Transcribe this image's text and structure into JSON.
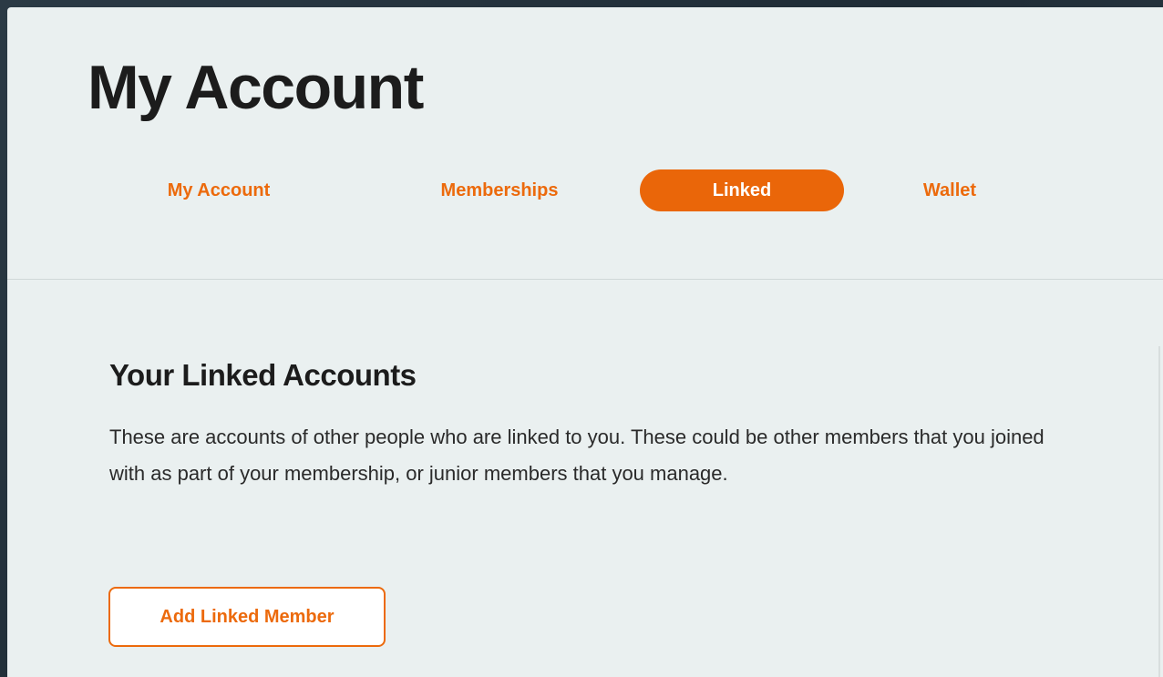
{
  "page": {
    "title": "My Account"
  },
  "tabs": [
    {
      "label": "My Account",
      "active": false
    },
    {
      "label": "Memberships",
      "active": false
    },
    {
      "label": "Linked",
      "active": true
    },
    {
      "label": "Wallet",
      "active": false
    }
  ],
  "linked_section": {
    "title": "Your Linked Accounts",
    "description": "These are accounts of other people who are linked to you. These could be other members that you joined with as part of your membership, or junior members that you manage.",
    "add_button_label": "Add Linked Member"
  },
  "colors": {
    "accent": "#ea6609",
    "panel_background": "#eaf0f0",
    "text": "#1c1c1c"
  }
}
